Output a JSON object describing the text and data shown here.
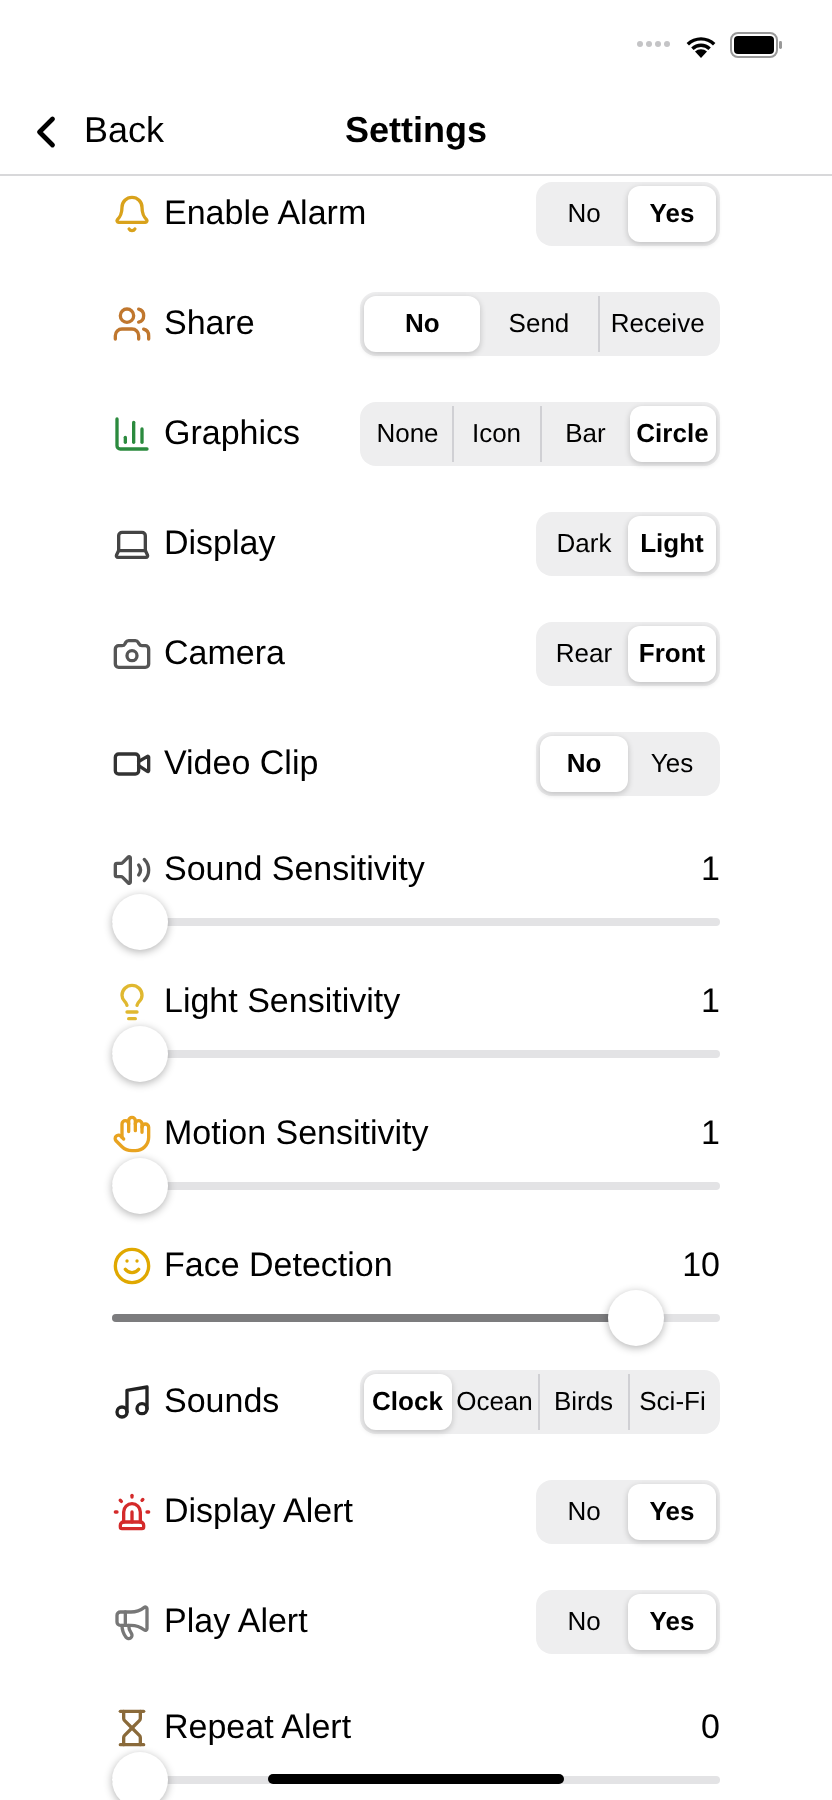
{
  "nav": {
    "back": "Back",
    "title": "Settings"
  },
  "rows": [
    {
      "kind": "segmented",
      "label": "Enable Alarm",
      "options": [
        {
          "label": "No",
          "selected": false
        },
        {
          "label": "Yes",
          "selected": true
        }
      ]
    },
    {
      "kind": "segmented",
      "label": "Share",
      "options": [
        {
          "label": "No",
          "selected": true
        },
        {
          "label": "Send",
          "selected": false
        },
        {
          "label": "Receive",
          "selected": false
        }
      ]
    },
    {
      "kind": "segmented",
      "label": "Graphics",
      "options": [
        {
          "label": "None",
          "selected": false
        },
        {
          "label": "Icon",
          "selected": false
        },
        {
          "label": "Bar",
          "selected": false
        },
        {
          "label": "Circle",
          "selected": true
        }
      ]
    },
    {
      "kind": "segmented",
      "label": "Display",
      "options": [
        {
          "label": "Dark",
          "selected": false
        },
        {
          "label": "Light",
          "selected": true
        }
      ]
    },
    {
      "kind": "segmented",
      "label": "Camera",
      "options": [
        {
          "label": "Rear",
          "selected": false
        },
        {
          "label": "Front",
          "selected": true
        }
      ]
    },
    {
      "kind": "segmented",
      "label": "Video Clip",
      "options": [
        {
          "label": "No",
          "selected": true
        },
        {
          "label": "Yes",
          "selected": false
        }
      ]
    },
    {
      "kind": "slider",
      "label": "Sound Sensitivity",
      "reading": "1",
      "level": 0
    },
    {
      "kind": "slider",
      "label": "Light Sensitivity",
      "reading": "1",
      "level": 0
    },
    {
      "kind": "slider",
      "label": "Motion Sensitivity",
      "reading": "1",
      "level": 0
    },
    {
      "kind": "slider",
      "label": "Face Detection",
      "reading": "10",
      "level": 0.9
    },
    {
      "kind": "segmented",
      "label": "Sounds",
      "options": [
        {
          "label": "Clock",
          "selected": true
        },
        {
          "label": "Ocean",
          "selected": false
        },
        {
          "label": "Birds",
          "selected": false
        },
        {
          "label": "Sci-Fi",
          "selected": false
        }
      ]
    },
    {
      "kind": "segmented",
      "label": "Display Alert",
      "options": [
        {
          "label": "No",
          "selected": false
        },
        {
          "label": "Yes",
          "selected": true
        }
      ]
    },
    {
      "kind": "segmented",
      "label": "Play Alert",
      "options": [
        {
          "label": "No",
          "selected": false
        },
        {
          "label": "Yes",
          "selected": true
        }
      ]
    },
    {
      "kind": "slider",
      "label": "Repeat Alert",
      "reading": "0",
      "level": 0
    }
  ]
}
